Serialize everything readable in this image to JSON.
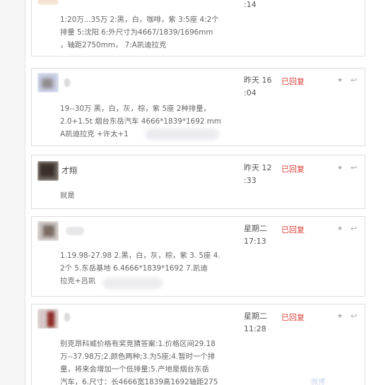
{
  "messages": [
    {
      "name": "",
      "body": [
        "1:20万...35万 2:黑，白，咖啡，紫 3:5座 4:2个",
        "排量 5:沈阳 6:外尺寸为4667/1839/1696mm",
        "，轴距2750mm， 7:A凯迪拉克"
      ],
      "time": [
        ":14"
      ],
      "status": "",
      "star_icon": "star-icon",
      "reply_icon": "reply-icon"
    },
    {
      "name": "",
      "body": [
        "19--30万 黑，白，灰，棕，紫 5座 2种排量，",
        "2.0+1.5t 烟台东岳汽车 4666*1839*1692 mm",
        "A凯迪拉克 +许太+1"
      ],
      "time": [
        "昨天 16",
        ":04"
      ],
      "status": "已回复",
      "star_icon": "star-icon",
      "reply_icon": "reply-icon"
    },
    {
      "name": "才翔",
      "body": [
        "就是"
      ],
      "time": [
        "昨天 12",
        ":33"
      ],
      "status": "已回复",
      "star_icon": "star-icon",
      "reply_icon": "reply-icon"
    },
    {
      "name": "",
      "body": [
        "1.19.98-27.98 2.黑，白，灰，棕，紫 3. 5座 4.",
        "2个 5.东岳基地 6.4666*1839*1692 7.凯迪",
        "拉克+吕凯"
      ],
      "time": [
        "星期二",
        "17:13"
      ],
      "status": "已回复",
      "star_icon": "star-icon",
      "reply_icon": "reply-icon"
    },
    {
      "name": "",
      "body": [
        "别克昂科威价格有奖竞猜答案:1.价格区间29.18",
        "万--37.98万;2.颜色两种;3.为5座;4.暂时一个排",
        "量，将来会增加一个低排量;5.产地是烟台东岳",
        "汽车，6.尺寸：长4666宽1839高1692轴距275"
      ],
      "time": [
        "星期二",
        "11:28"
      ],
      "status": "已回复",
      "star_icon": "star-icon",
      "reply_icon": "reply-icon"
    }
  ],
  "watermark": "微博"
}
